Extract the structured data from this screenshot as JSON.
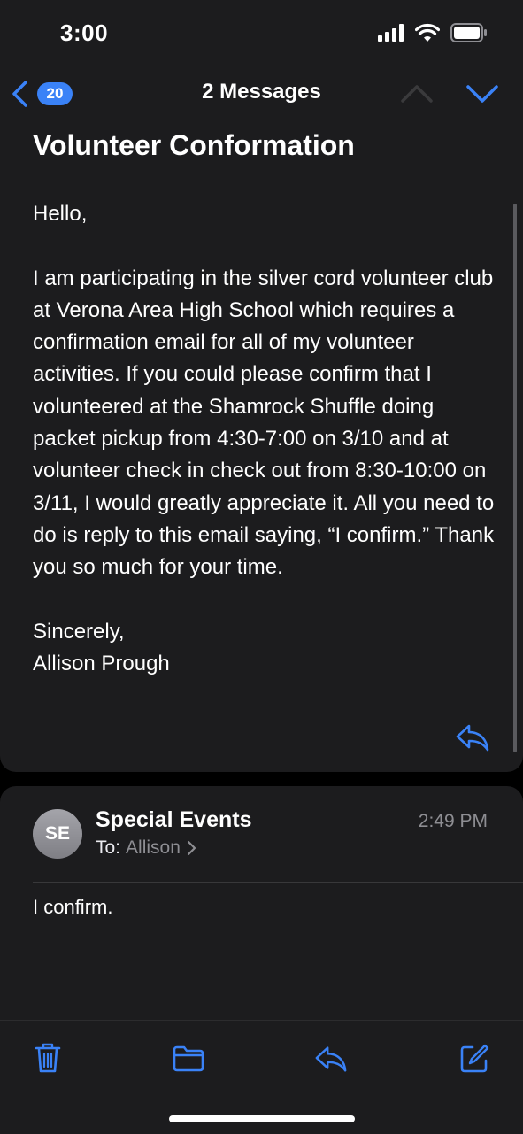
{
  "status": {
    "time": "3:00"
  },
  "nav": {
    "back_count": "20",
    "title": "2 Messages"
  },
  "message1": {
    "subject": "Volunteer Conformation",
    "body": "Hello,\n\nI am participating in the silver cord volunteer club at Verona Area High School which requires a confirmation email for all of my volunteer activities. If you could please confirm that I volunteered at the Shamrock Shuffle doing packet pickup from 4:30-7:00 on 3/10 and at volunteer check in check out from 8:30-10:00 on 3/11, I would greatly appreciate it. All you need to do is reply to this email saying, “I confirm.” Thank you so much for your time.\n\nSincerely,\nAllison Prough"
  },
  "message2": {
    "avatar_initials": "SE",
    "sender": "Special Events",
    "to_label": "To:",
    "to_name": "Allison",
    "time": "2:49 PM",
    "body": "I confirm."
  },
  "colors": {
    "accent": "#3a82f7",
    "background": "#1c1c1e"
  },
  "toolbar": {
    "icons": [
      "trash-icon",
      "folder-icon",
      "reply-icon",
      "compose-icon"
    ]
  }
}
